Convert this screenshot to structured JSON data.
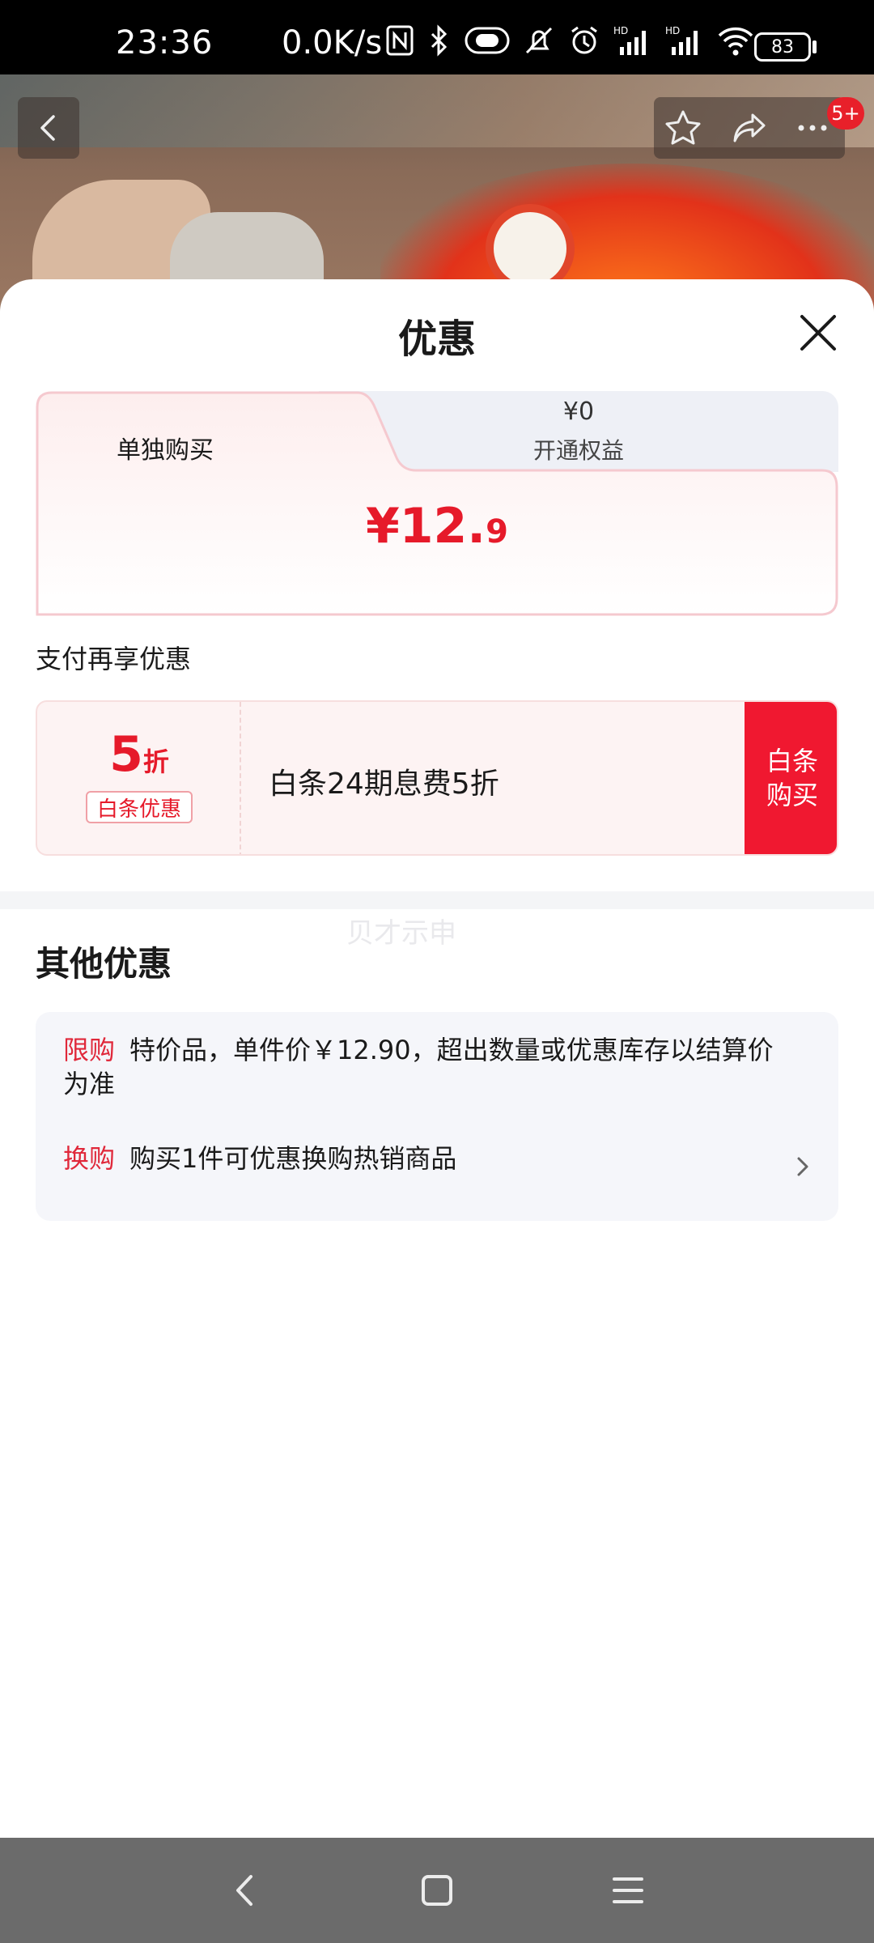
{
  "status_bar": {
    "time": "23:36",
    "net_speed": "0.0K/s",
    "battery": "83",
    "icons": [
      "nfc-icon",
      "bluetooth-icon",
      "toggle-icon",
      "mute-icon",
      "alarm-icon",
      "signal-hd-icon",
      "signal-hd-icon",
      "wifi-icon"
    ]
  },
  "header": {
    "badge": "5+",
    "icons": [
      "back-icon",
      "star-icon",
      "share-icon",
      "more-icon"
    ]
  },
  "sheet": {
    "title": "优惠",
    "tabs": {
      "single": "单独购买",
      "member_price": "¥0",
      "member_label": "开通权益"
    },
    "price": {
      "main": "¥12.",
      "decimal": "9"
    },
    "pay_section_label": "支付再享优惠",
    "promo": {
      "discount_number": "5",
      "discount_unit": "折",
      "tag": "白条优惠",
      "description": "白条24期息费5折",
      "buy_line1": "白条",
      "buy_line2": "购买"
    },
    "watermark": "贝才示申",
    "other_title": "其他优惠",
    "other_offers": [
      {
        "tag": "限购",
        "text": "特价品，单件价￥12.90，超出数量或优惠库存以结算价为准"
      },
      {
        "tag": "换购",
        "text": "购买1件可优惠换购热销商品"
      }
    ]
  },
  "colors": {
    "accent_red": "#e61a2a",
    "buy_button": "#f01830",
    "card_bg": "#f5f6fa"
  }
}
